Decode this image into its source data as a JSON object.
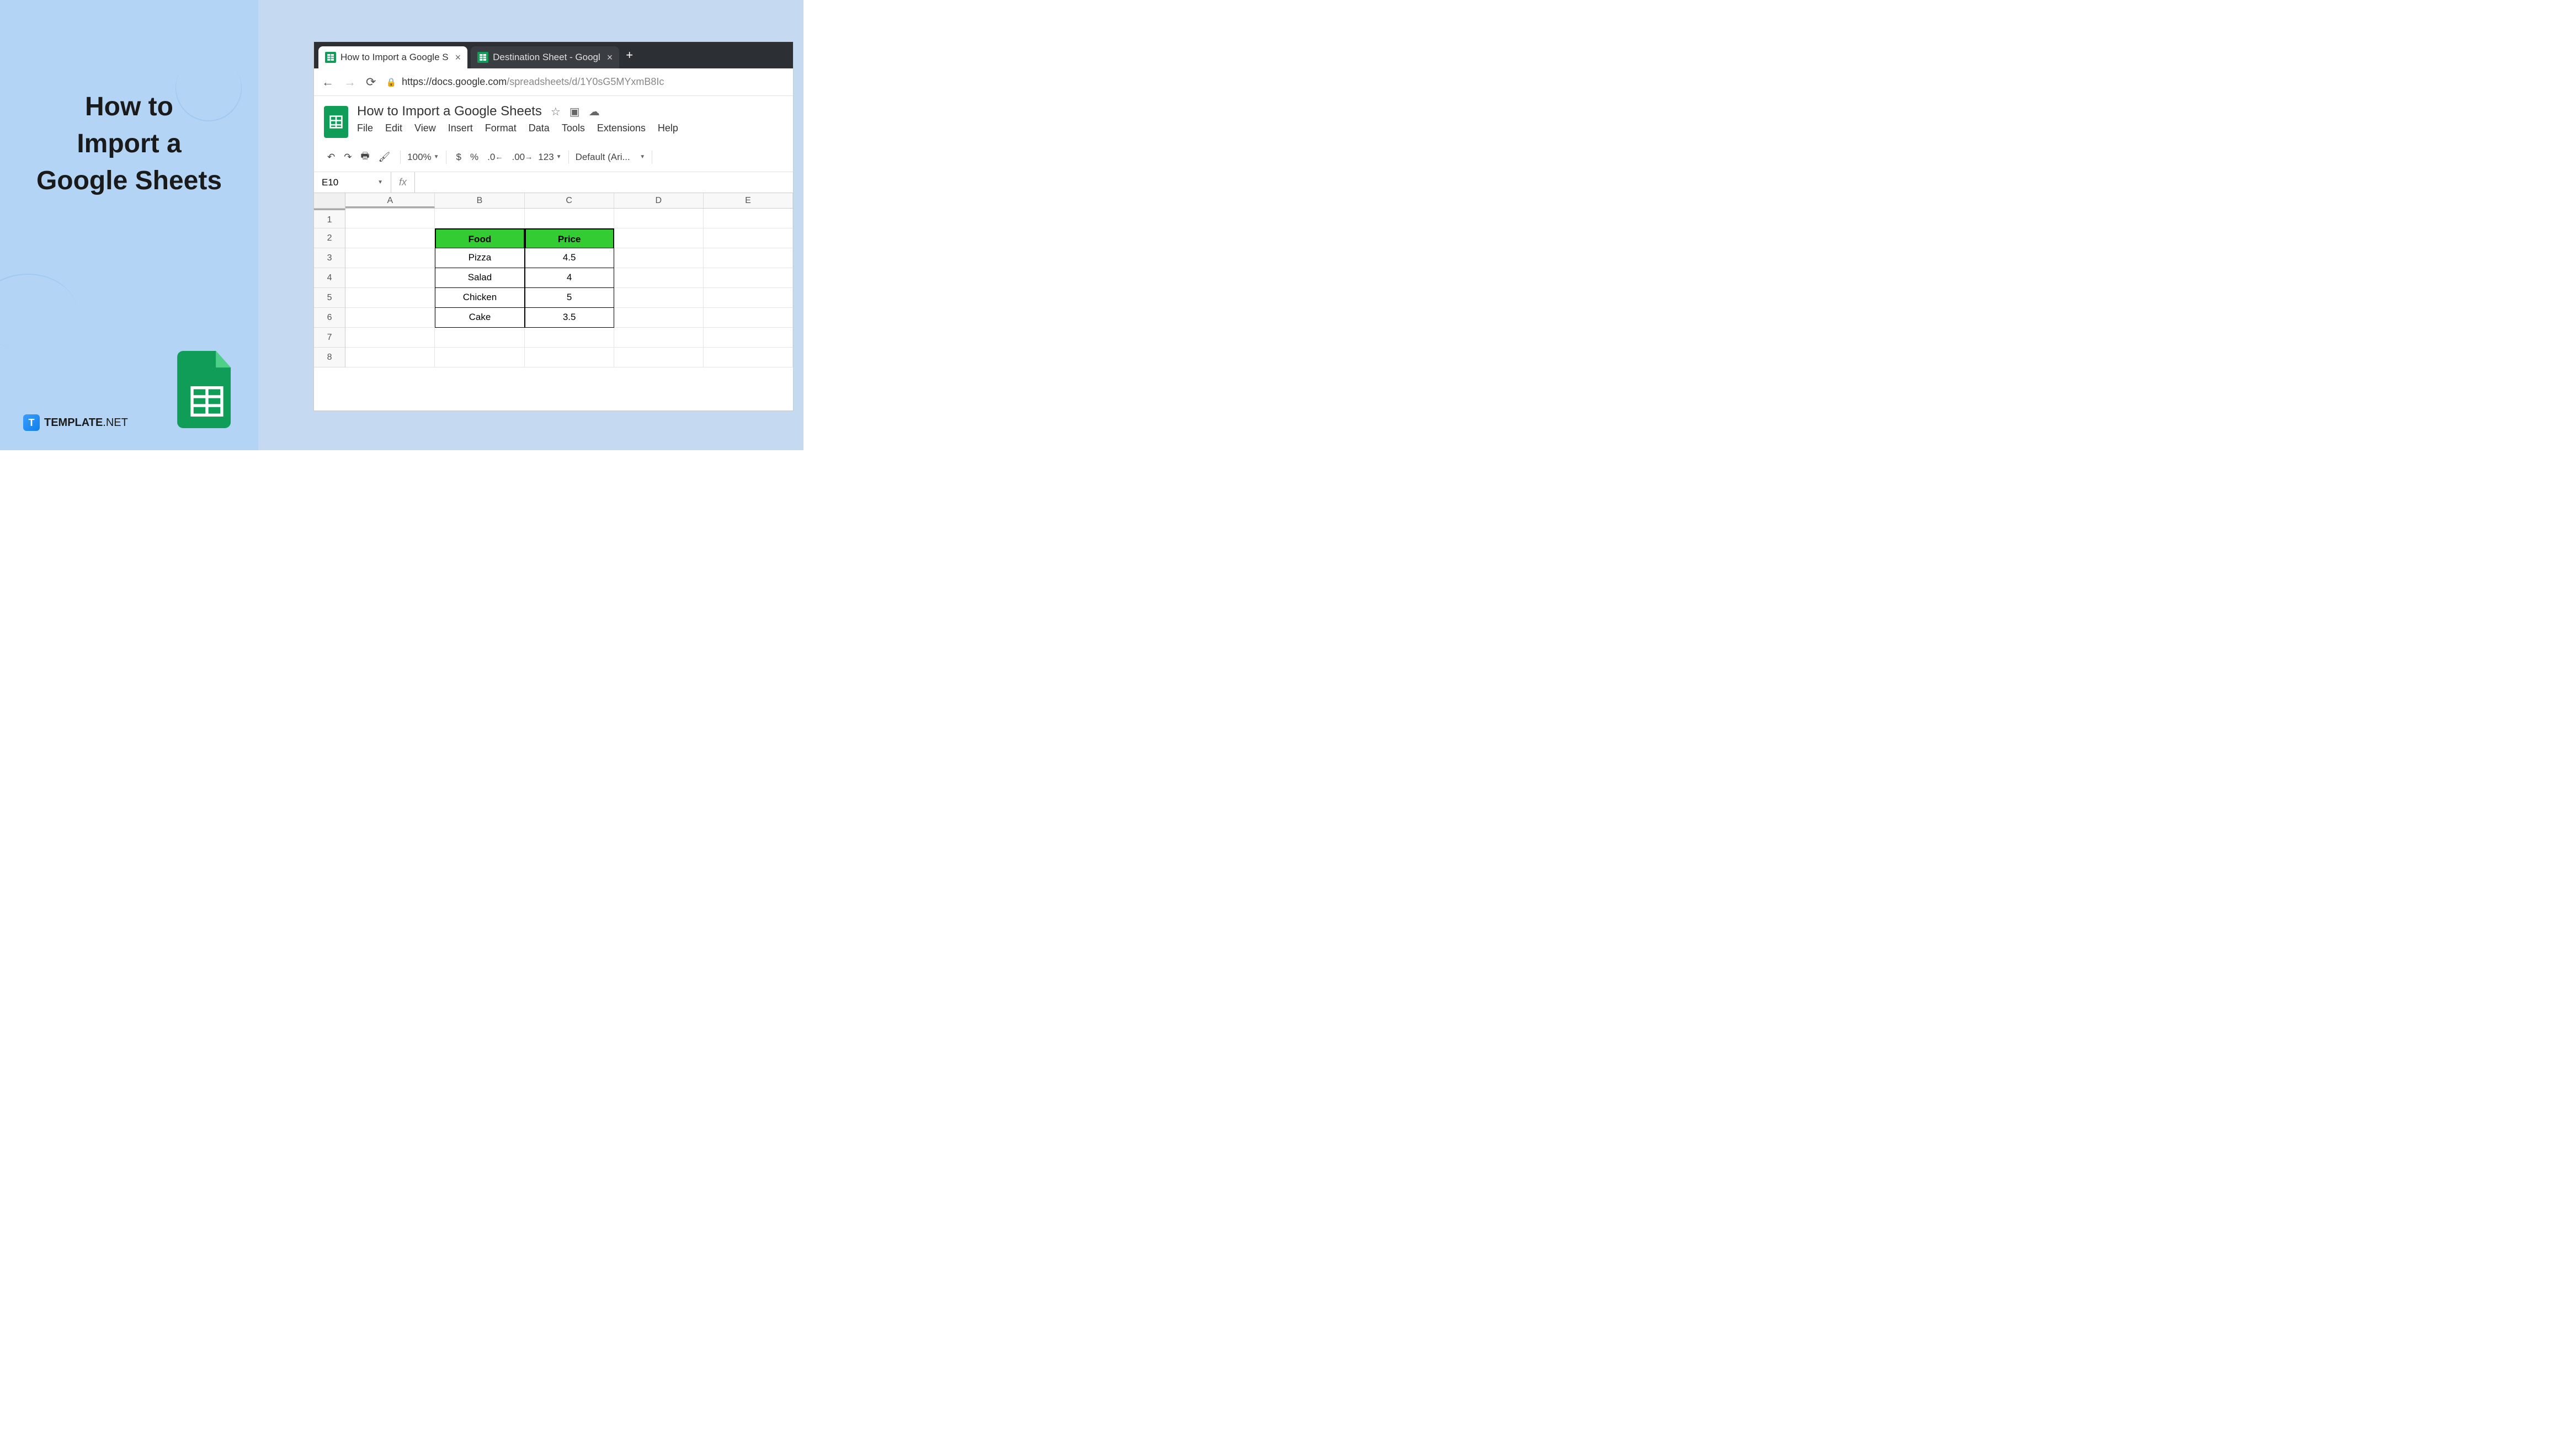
{
  "left": {
    "title_line1": "How to",
    "title_line2": "Import a",
    "title_line3": "Google Sheets",
    "brand_name": "TEMPLATE",
    "brand_suffix": ".NET"
  },
  "browser": {
    "tabs": [
      {
        "title": "How to Import a Google S",
        "active": true
      },
      {
        "title": "Destination Sheet - Googl",
        "active": false
      }
    ],
    "url_domain": "https://docs.google.com",
    "url_path": "/spreadsheets/d/1Y0sG5MYxmB8Ic"
  },
  "doc": {
    "title": "How to Import a Google Sheets",
    "menus": [
      "File",
      "Edit",
      "View",
      "Insert",
      "Format",
      "Data",
      "Tools",
      "Extensions",
      "Help"
    ]
  },
  "toolbar": {
    "zoom": "100%",
    "currency": "$",
    "percent": "%",
    "dec_decrease": ".0",
    "dec_increase": ".00",
    "format123": "123",
    "font": "Default (Ari..."
  },
  "formula": {
    "cell_ref": "E10",
    "fx": "fx"
  },
  "grid": {
    "columns": [
      "A",
      "B",
      "C",
      "D",
      "E"
    ],
    "row_numbers": [
      "1",
      "2",
      "3",
      "4",
      "5",
      "6",
      "7",
      "8"
    ],
    "headers": [
      "Food",
      "Price"
    ],
    "rows": [
      [
        "Pizza",
        "4.5"
      ],
      [
        "Salad",
        "4"
      ],
      [
        "Chicken",
        "5"
      ],
      [
        "Cake",
        "3.5"
      ]
    ]
  }
}
